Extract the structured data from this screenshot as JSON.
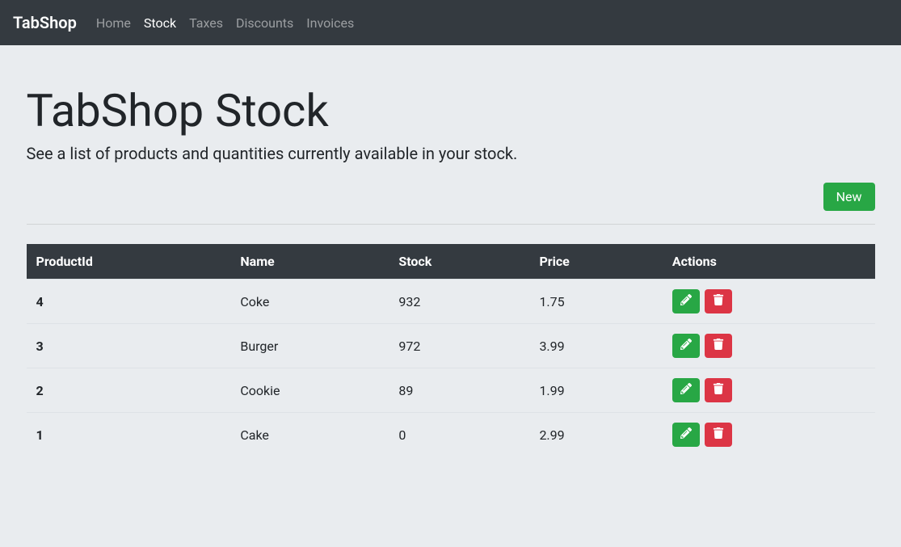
{
  "navbar": {
    "brand": "TabShop",
    "items": [
      {
        "label": "Home",
        "active": false
      },
      {
        "label": "Stock",
        "active": true
      },
      {
        "label": "Taxes",
        "active": false
      },
      {
        "label": "Discounts",
        "active": false
      },
      {
        "label": "Invoices",
        "active": false
      }
    ]
  },
  "page": {
    "title": "TabShop Stock",
    "subtitle": "See a list of products and quantities currently available in your stock.",
    "newButton": "New"
  },
  "table": {
    "headers": {
      "productId": "ProductId",
      "name": "Name",
      "stock": "Stock",
      "price": "Price",
      "actions": "Actions"
    },
    "rows": [
      {
        "productId": "4",
        "name": "Coke",
        "stock": "932",
        "price": "1.75"
      },
      {
        "productId": "3",
        "name": "Burger",
        "stock": "972",
        "price": "3.99"
      },
      {
        "productId": "2",
        "name": "Cookie",
        "stock": "89",
        "price": "1.99"
      },
      {
        "productId": "1",
        "name": "Cake",
        "stock": "0",
        "price": "2.99"
      }
    ]
  },
  "icons": {
    "edit": "edit-icon",
    "delete": "trash-icon"
  }
}
